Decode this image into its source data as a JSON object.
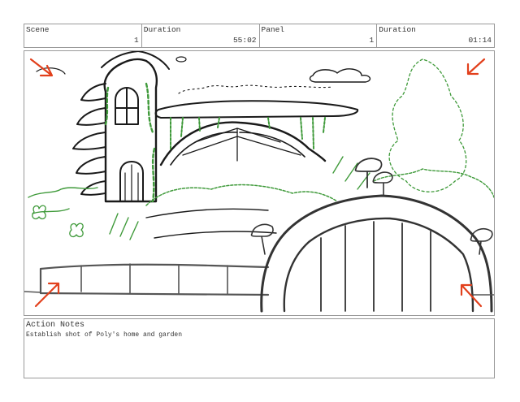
{
  "header": {
    "scene_label": "Scene",
    "scene_value": "1",
    "duration1_label": "Duration",
    "duration1_value": "55:02",
    "panel_label": "Panel",
    "panel_value": "1",
    "duration2_label": "Duration",
    "duration2_value": "01:14"
  },
  "notes": {
    "title": "Action Notes",
    "text": "Establish shot of Poly's home and garden"
  },
  "colors": {
    "arrow": "#e2401c",
    "sketch_line": "#1a1a1a",
    "foliage": "#3f9a3a",
    "frame_border": "#9a9a9a"
  },
  "icons": [
    "corner-arrow-icon"
  ]
}
